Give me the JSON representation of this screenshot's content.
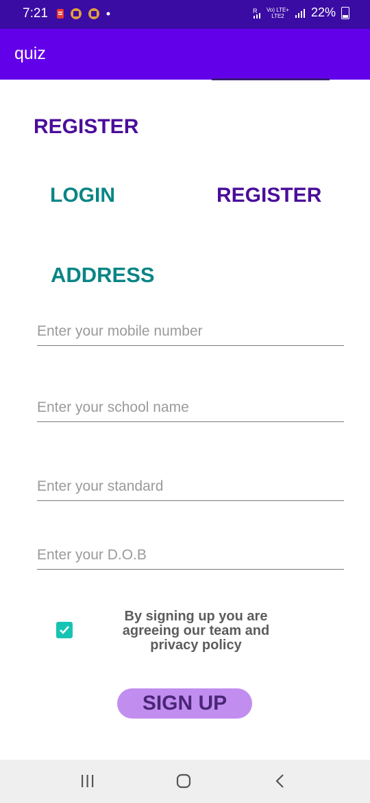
{
  "status_bar": {
    "time": "7:21",
    "network_top": "Vo) LTE+",
    "network_bottom": "LTE2",
    "battery": "22%"
  },
  "app_bar": {
    "title": "quiz"
  },
  "screen": {
    "heading": "REGISTER",
    "tabs": [
      {
        "label": "LOGIN",
        "selected": false
      },
      {
        "label": "REGISTER",
        "selected": true
      }
    ],
    "section_title": "ADDRESS"
  },
  "form": {
    "fields": [
      {
        "placeholder": "Enter your mobile number",
        "value": ""
      },
      {
        "placeholder": "Enter your school name",
        "value": ""
      },
      {
        "placeholder": "Enter your standard",
        "value": ""
      },
      {
        "placeholder": "Enter your D.O.B",
        "value": ""
      }
    ],
    "agree_checked": true,
    "terms_text": "By signing up you are agreeing our  team and privacy policy",
    "signup_label": "SIGN UP"
  },
  "nav": {
    "recent_icon": "recent-apps-icon",
    "home_icon": "home-icon",
    "back_icon": "back-icon"
  },
  "colors": {
    "status_bar": "#3a0ca3",
    "app_bar": "#6200ea",
    "purple_text": "#4a0e9a",
    "teal_text": "#0a8585",
    "checkbox": "#17c4b3",
    "button": "#c18ef0"
  }
}
